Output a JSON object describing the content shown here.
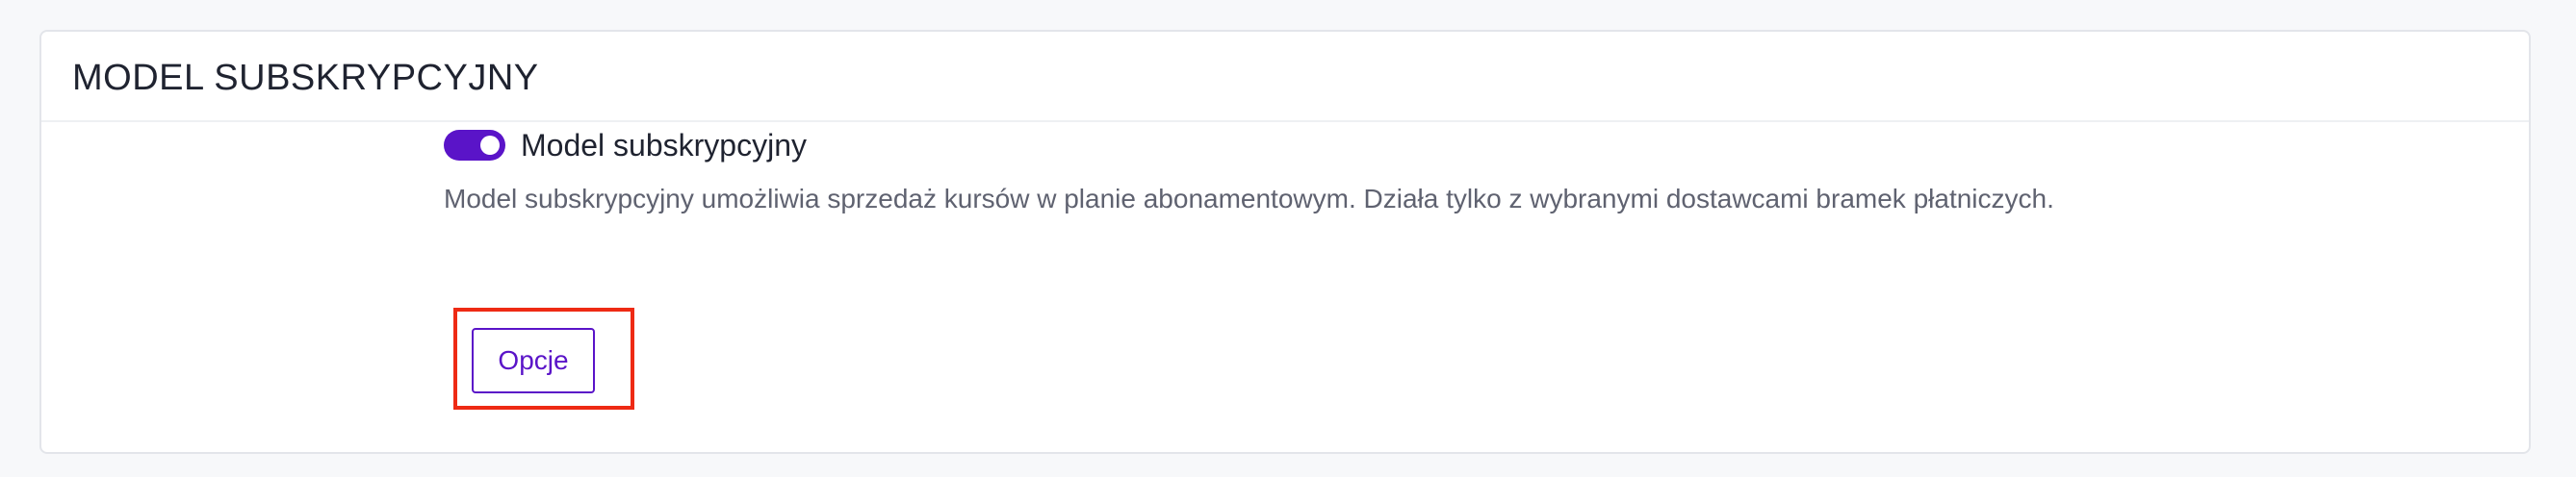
{
  "card": {
    "title": "MODEL SUBSKRYPCYJNY"
  },
  "subscription_setting": {
    "toggle_label": "Model subskrypcyjny",
    "toggle_on": true,
    "description": "Model subskrypcyjny umożliwia sprzedaż kursów w planie abonamentowym. Działa tylko z wybranymi dostawcami bramek płatniczych.",
    "options_button_label": "Opcje"
  },
  "colors": {
    "accent": "#5a14c8",
    "highlight_border": "#ee2a14"
  }
}
